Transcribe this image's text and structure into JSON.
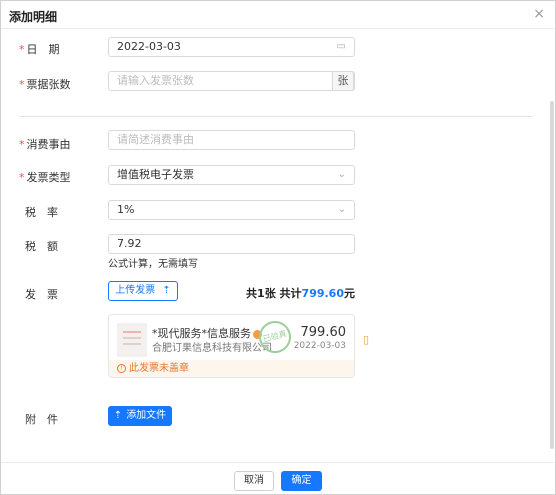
{
  "dialog": {
    "title": "添加明细",
    "close_icon": "×"
  },
  "form": {
    "date": {
      "label": "日　期",
      "value": "2022-03-03",
      "icon": "calendar-icon"
    },
    "ticket_count": {
      "label": "票据张数",
      "placeholder": "请输入发票张数",
      "unit": "张"
    },
    "purpose": {
      "label": "消费事由",
      "placeholder": "请简述消费事由"
    },
    "invoice_type": {
      "label": "发票类型",
      "value": "增值税电子发票",
      "icon": "chevron-down-icon"
    },
    "tax_rate": {
      "label": "税　率",
      "value": "1%",
      "icon": "chevron-down-icon"
    },
    "tax_amount": {
      "label": "税　额",
      "value": "7.92",
      "hint": "公式计算，无需填写"
    },
    "invoice": {
      "label": "发　票",
      "upload_label": "上传发票",
      "summary_prefix": "共",
      "count": "1",
      "summary_mid": "张 共计",
      "total": "799.60",
      "summary_suffix": "元"
    },
    "attachment": {
      "label": "附　件",
      "button_label": "添加文件"
    }
  },
  "invoice_card": {
    "name": "*现代服务*信息服务",
    "seller": "合肥订果信息科技有限公司",
    "stamp_text": "已验真",
    "price": "799.60",
    "date": "2022-03-03",
    "warning": "此发票未盖章"
  },
  "footer": {
    "cancel_label": "取消",
    "ok_label": "确定"
  },
  "colors": {
    "primary": "#1677ff",
    "required": "#f05050",
    "warning": "#e6762f"
  }
}
